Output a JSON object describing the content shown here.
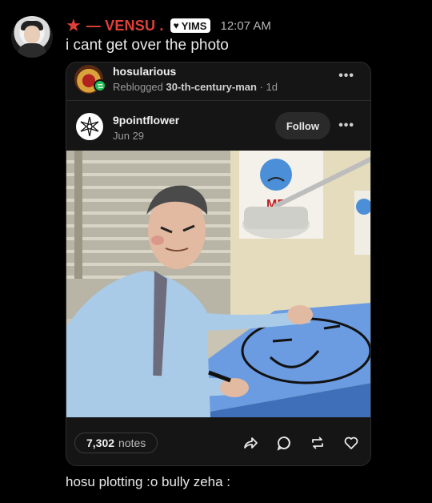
{
  "message": {
    "star_glyph": "★",
    "username": "— VENSU .",
    "tag_heart": "♥",
    "tag_label": "YIMS",
    "timestamp": "12:07 AM",
    "text": "i cant get over the photo",
    "caption": "hosu plotting :o bully zeha :",
    "username_color": "#e0403a"
  },
  "post": {
    "reblogger": "hosularious",
    "reblog_prefix": "Reblogged",
    "reblog_source": "30-th-century-man",
    "reblog_age": "· 1d",
    "author": "9pointflower",
    "date": "Jun 29",
    "follow_label": "Follow",
    "menu_dots": "•••",
    "notes_count": "7,302",
    "notes_label": "notes",
    "photo_sign_text": "ME",
    "reblog_badge_color": "#1fbf55"
  },
  "icons": [
    "share-icon",
    "reply-icon",
    "reblog-icon",
    "like-icon"
  ]
}
